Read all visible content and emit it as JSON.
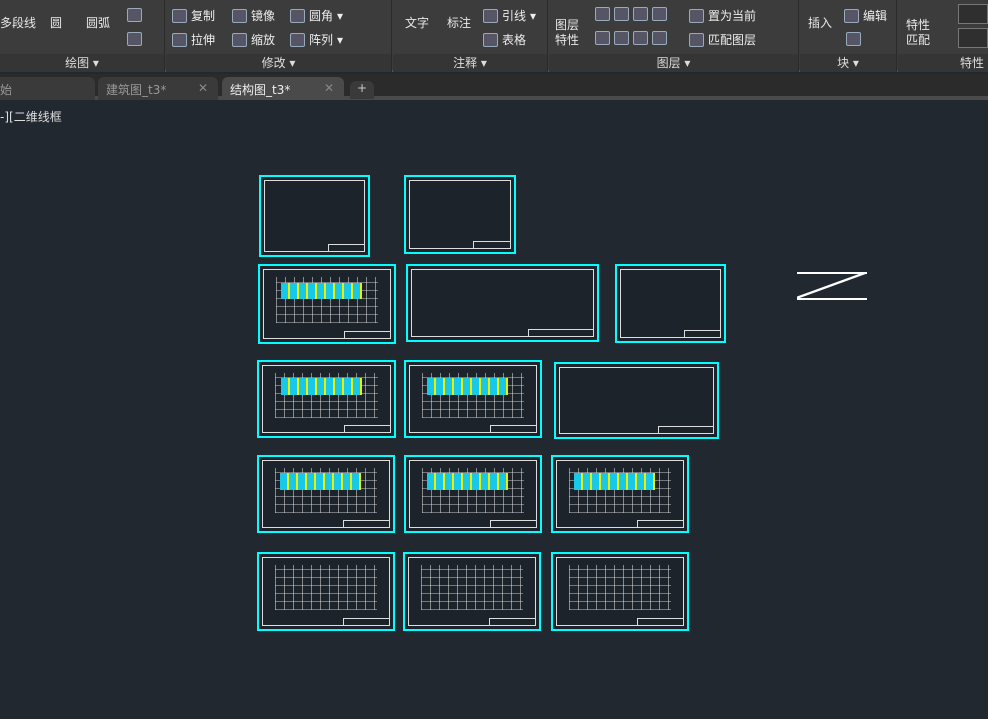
{
  "ribbon": {
    "draw": {
      "title": "绘图",
      "polyline": "多段线",
      "circle": "圆",
      "arc": "圆弧"
    },
    "modify": {
      "title": "修改",
      "copy": "复制",
      "mirror": "镜像",
      "fillet": "圆角",
      "stretch": "拉伸",
      "scale": "缩放",
      "array": "阵列"
    },
    "annotation": {
      "title": "注释",
      "text": "文字",
      "dimension": "标注",
      "leader": "引线",
      "table": "表格"
    },
    "layers": {
      "title": "图层",
      "properties": "图层\n特性",
      "set_current": "置为当前",
      "match_layer": "匹配图层"
    },
    "block": {
      "title": "块",
      "insert": "插入",
      "edit": "编辑"
    },
    "properties": {
      "title": "特性",
      "match": "特性\n匹配"
    }
  },
  "tabs": [
    {
      "label": "始"
    },
    {
      "label": "建筑图_t3*"
    },
    {
      "label": "结构图_t3*"
    }
  ],
  "viewport": {
    "label": "-][二维线框"
  },
  "colors": {
    "sheet_border": "#00ffff",
    "fill_yellow": "#eeee00",
    "fill_cyan": "#18c8e8",
    "background": "#212830"
  }
}
